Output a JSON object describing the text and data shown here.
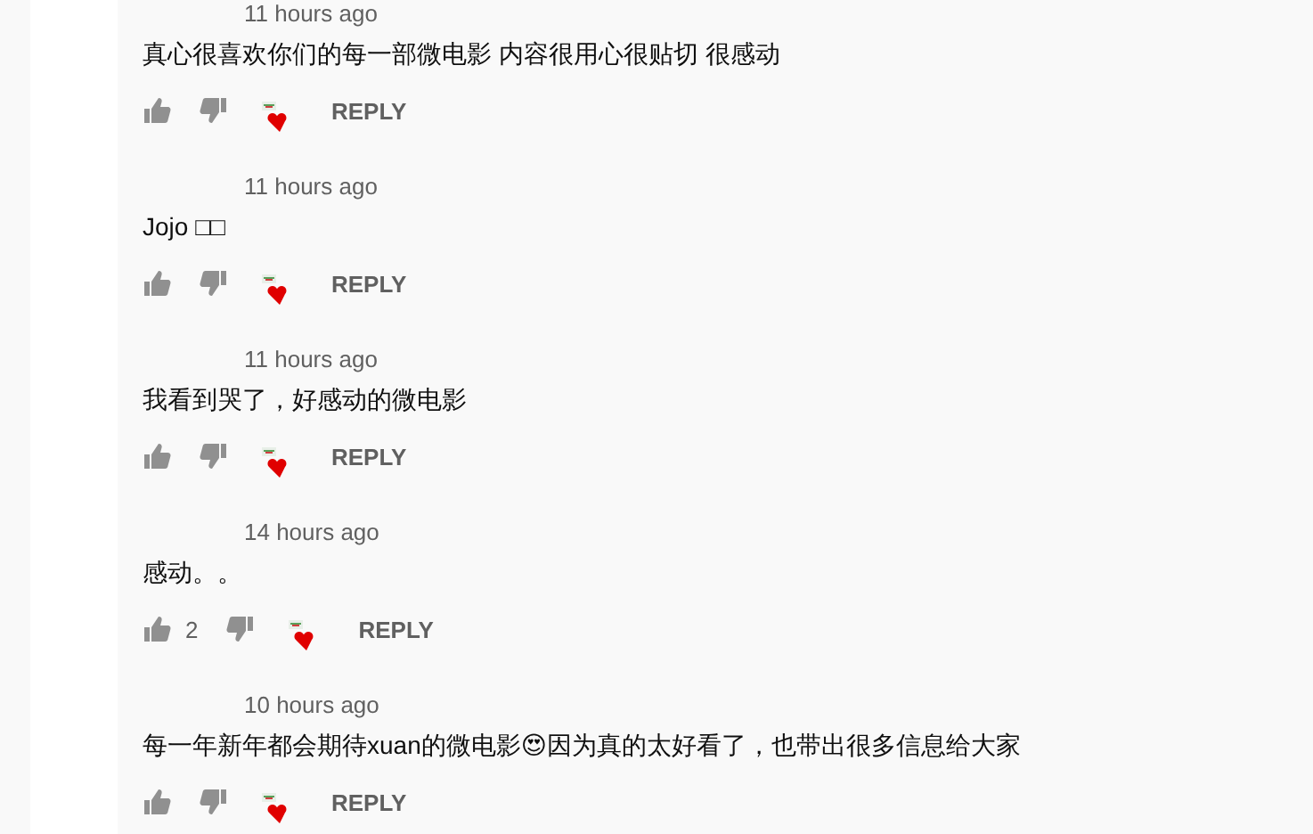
{
  "comments": [
    {
      "time": "11 hours ago",
      "text": "真心很喜欢你们的每一部微电影 内容很用心很贴切  很感动",
      "hearted": true,
      "reply": "REPLY"
    },
    {
      "time": "11 hours ago",
      "text": "Jojo □□",
      "hearted": true,
      "reply": "REPLY"
    },
    {
      "time": "11 hours ago",
      "text": "我看到哭了，好感动的微电影",
      "hearted": true,
      "reply": "REPLY"
    },
    {
      "time": "14 hours ago",
      "text": "感动。。",
      "likes": "2",
      "hearted": true,
      "reply": "REPLY"
    },
    {
      "time": "10 hours ago",
      "text": "每一年新年都会期待xuan的微电影😍因为真的太好看了，也带出很多信息给大家",
      "hearted": true,
      "reply": "REPLY"
    }
  ]
}
